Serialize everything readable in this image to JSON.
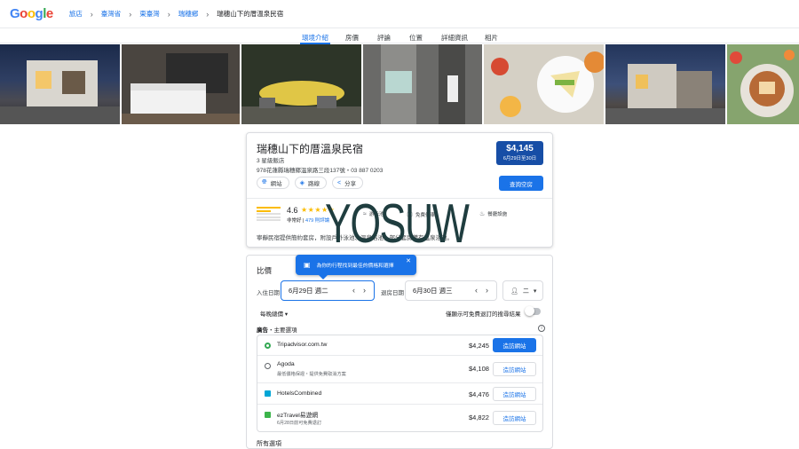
{
  "header": {
    "logo": "Google",
    "breadcrumbs": [
      "旅店",
      "臺灣省",
      "東臺灣",
      "瑞穗鄉",
      "瑞穗山下的厝溫泉民宿"
    ]
  },
  "tabs": [
    "環境介紹",
    "房價",
    "評論",
    "位置",
    "詳細資訊",
    "相片"
  ],
  "active_tab": "環境介紹",
  "photos": [
    {
      "desc": "night exterior of villa"
    },
    {
      "desc": "bedroom"
    },
    {
      "desc": "outdoor pool at night"
    },
    {
      "desc": "bathroom"
    },
    {
      "desc": "breakfast sandwiches"
    },
    {
      "desc": "exterior dusk"
    },
    {
      "desc": "cake on table"
    }
  ],
  "hotel": {
    "name": "瑞穗山下的厝溫泉民宿",
    "class": "3 星級飯店",
    "address": "978花蓮縣瑞穗鄉溫泉路三段137號・03 887 0203",
    "price": "$4,145",
    "price_dates": "6月29日至30日",
    "chips": [
      {
        "icon": "globe-icon",
        "label": "網站"
      },
      {
        "icon": "directions-icon",
        "label": "路線"
      },
      {
        "icon": "share-icon",
        "label": "分享"
      }
    ],
    "availability_button": "查詢空房",
    "rating": "4.6",
    "stars": "★★★★★",
    "rating_label": "非常好",
    "review_count": "479 則評論",
    "amenities": [
      "游泳池",
      "免費停車",
      "餐廳設施"
    ],
    "description": "寧靜民宿提供簡約套房，附設戶外泳池、溫泉浴池，部分套房備有溫泉浴池。"
  },
  "watermark": "YOSUW",
  "prices": {
    "title": "比價",
    "tooltip": "為你的行程找到最佳的價格和選擇",
    "checkin_label": "入住日期",
    "checkin_value": "6月29日 週二",
    "checkout_label": "退房日期",
    "checkout_value": "6月30日 週三",
    "guests": "二",
    "nightly": "每晚總價",
    "free_cancel": "僅顯示可免費退訂的搜尋結果",
    "ad_prefix": "廣告",
    "ad_suffix": "・主要選項",
    "offers": [
      {
        "name": "Tripadvisor.com.tw",
        "sub": "",
        "price": "$4,245",
        "button": "造訪網站",
        "color": "#34a853",
        "primary": true
      },
      {
        "name": "Agoda",
        "sub": "最低價格保證・提供免費取消方案",
        "price": "$4,108",
        "button": "造訪網站",
        "color": "#5f6368",
        "primary": false
      },
      {
        "name": "HotelsCombined",
        "sub": "",
        "price": "$4,476",
        "button": "造訪網站",
        "color": "#00a6d6",
        "primary": false
      },
      {
        "name": "ezTravel易遊網",
        "sub": "6月28日前可免費退訂",
        "price": "$4,822",
        "button": "造訪網站",
        "color": "#3cb44b",
        "primary": false
      }
    ],
    "all_options": "所有選項"
  }
}
